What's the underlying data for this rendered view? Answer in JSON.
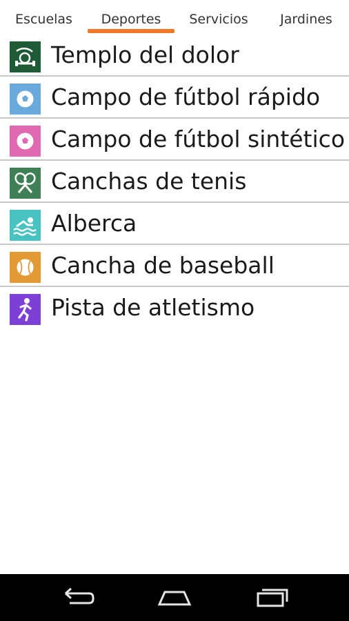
{
  "tabs": [
    {
      "label": "Escuelas",
      "active": false
    },
    {
      "label": "Deportes",
      "active": true
    },
    {
      "label": "Servicios",
      "active": false
    },
    {
      "label": "Jardines",
      "active": false
    }
  ],
  "colors": {
    "accent": "#ef7a2a",
    "divider": "#c9c9c9",
    "icon_templo": "#1f5a36",
    "icon_futbol_rapido": "#6aa9dd",
    "icon_futbol_sintetico": "#e06ab0",
    "icon_tenis": "#3f7f56",
    "icon_alberca": "#49c3c2",
    "icon_baseball": "#e39a35",
    "icon_atletismo": "#7e3fd6"
  },
  "items": [
    {
      "label": "Templo del dolor",
      "icon": "dumbbell-icon"
    },
    {
      "label": "Campo de fútbol rápido",
      "icon": "soccer-ball-icon"
    },
    {
      "label": "Campo de fútbol sintético",
      "icon": "soccer-ball-icon"
    },
    {
      "label": "Canchas de tenis",
      "icon": "tennis-rackets-icon"
    },
    {
      "label": "Alberca",
      "icon": "swimmer-icon"
    },
    {
      "label": "Cancha de baseball",
      "icon": "baseball-icon"
    },
    {
      "label": "Pista de atletismo",
      "icon": "runner-icon"
    }
  ],
  "navbar": {
    "back": "back-icon",
    "home": "home-icon",
    "recents": "recent-apps-icon"
  }
}
